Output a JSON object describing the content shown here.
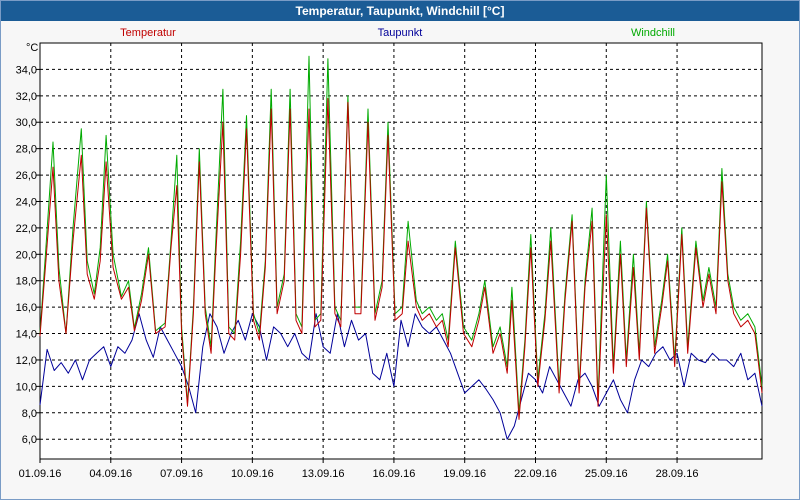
{
  "window": {
    "title": "Temperatur, Taupunkt, Windchill [°C]"
  },
  "chart_data": {
    "type": "line",
    "title": "Temperatur, Taupunkt, Windchill [°C]",
    "ylabel": "°C",
    "xlabel": "",
    "ylim": [
      4.5,
      36.0
    ],
    "xlim": [
      0,
      30.6
    ],
    "yticks": [
      6.0,
      8.0,
      10.0,
      12.0,
      14.0,
      16.0,
      18.0,
      20.0,
      22.0,
      24.0,
      26.0,
      28.0,
      30.0,
      32.0,
      34.0
    ],
    "ytick_labels": [
      "6,0",
      "8,0",
      "10,0",
      "12,0",
      "14,0",
      "16,0",
      "18,0",
      "20,0",
      "22,0",
      "24,0",
      "26,0",
      "28,0",
      "30,0",
      "32,0",
      "34,0"
    ],
    "xticks": [
      0,
      3,
      6,
      9,
      12,
      15,
      18,
      21,
      24,
      27
    ],
    "xtick_labels": [
      "01.09.16",
      "04.09.16",
      "07.09.16",
      "10.09.16",
      "13.09.16",
      "16.09.16",
      "19.09.16",
      "22.09.16",
      "25.09.16",
      "28.09.16"
    ],
    "grid": true,
    "legend_position": "top",
    "series": [
      {
        "name": "Temperatur",
        "color": "#c00000",
        "x": [
          0.0,
          0.25,
          0.55,
          0.8,
          1.1,
          1.4,
          1.75,
          2.0,
          2.3,
          2.55,
          2.8,
          3.1,
          3.45,
          3.75,
          4.0,
          4.3,
          4.6,
          4.9,
          5.3,
          5.55,
          5.8,
          6.0,
          6.25,
          6.5,
          6.75,
          7.0,
          7.25,
          7.45,
          7.75,
          8.0,
          8.25,
          8.5,
          8.75,
          9.05,
          9.3,
          9.55,
          9.8,
          10.05,
          10.35,
          10.6,
          10.85,
          11.1,
          11.4,
          11.65,
          11.9,
          12.2,
          12.5,
          12.75,
          13.05,
          13.35,
          13.6,
          13.9,
          14.2,
          14.5,
          14.75,
          15.05,
          15.35,
          15.6,
          15.95,
          16.2,
          16.5,
          16.8,
          17.05,
          17.3,
          17.6,
          17.95,
          18.3,
          18.6,
          18.85,
          19.2,
          19.5,
          19.8,
          20.0,
          20.3,
          20.55,
          20.8,
          21.1,
          21.4,
          21.65,
          22.0,
          22.25,
          22.55,
          22.85,
          23.1,
          23.4,
          23.65,
          24.0,
          24.3,
          24.6,
          24.85,
          25.15,
          25.4,
          25.7,
          26.05,
          26.35,
          26.6,
          26.9,
          27.2,
          27.45,
          27.8,
          28.1,
          28.35,
          28.65,
          28.9,
          29.15,
          29.4,
          29.7,
          30.0,
          30.3,
          30.6
        ],
        "values": [
          13.8,
          19.5,
          26.6,
          18.0,
          14.0,
          21.0,
          27.5,
          18.5,
          16.6,
          19.5,
          27.0,
          19.0,
          16.6,
          17.5,
          14.2,
          16.5,
          20.0,
          14.0,
          14.5,
          20.5,
          25.2,
          14.0,
          8.5,
          15.5,
          27.0,
          15.5,
          12.5,
          20.0,
          30.0,
          14.0,
          13.5,
          20.0,
          29.5,
          15.0,
          13.5,
          19.0,
          31.0,
          15.5,
          18.0,
          31.0,
          15.0,
          14.0,
          31.0,
          14.5,
          15.0,
          31.8,
          15.5,
          14.5,
          31.5,
          15.5,
          15.5,
          30.0,
          15.0,
          17.5,
          29.0,
          15.0,
          15.5,
          21.0,
          16.0,
          15.0,
          15.5,
          14.5,
          15.0,
          13.0,
          20.5,
          14.0,
          13.0,
          15.0,
          17.5,
          12.5,
          14.0,
          11.0,
          16.5,
          7.5,
          13.0,
          20.5,
          10.0,
          15.0,
          21.0,
          9.5,
          16.5,
          22.5,
          9.5,
          17.5,
          22.5,
          8.5,
          23.0,
          11.0,
          20.0,
          11.5,
          19.0,
          12.0,
          23.5,
          12.5,
          16.0,
          19.5,
          11.5,
          21.5,
          12.5,
          20.5,
          16.0,
          18.5,
          15.5,
          25.5,
          18.0,
          15.5,
          14.5,
          15.0,
          14.0,
          9.5
        ]
      },
      {
        "name": "Taupunkt",
        "color": "#000099",
        "x": [
          0.0,
          0.3,
          0.6,
          0.9,
          1.2,
          1.5,
          1.8,
          2.1,
          2.4,
          2.7,
          3.0,
          3.3,
          3.6,
          3.9,
          4.2,
          4.5,
          4.8,
          5.1,
          5.4,
          5.7,
          6.0,
          6.3,
          6.6,
          6.9,
          7.2,
          7.5,
          7.8,
          8.1,
          8.4,
          8.7,
          9.0,
          9.3,
          9.6,
          9.9,
          10.2,
          10.5,
          10.8,
          11.1,
          11.4,
          11.7,
          12.0,
          12.3,
          12.6,
          12.9,
          13.2,
          13.5,
          13.8,
          14.1,
          14.4,
          14.7,
          15.0,
          15.3,
          15.6,
          15.9,
          16.2,
          16.5,
          16.8,
          17.1,
          17.4,
          17.7,
          18.0,
          18.3,
          18.6,
          18.9,
          19.2,
          19.5,
          19.8,
          20.1,
          20.4,
          20.7,
          21.0,
          21.3,
          21.6,
          21.9,
          22.2,
          22.5,
          22.8,
          23.1,
          23.4,
          23.7,
          24.0,
          24.3,
          24.6,
          24.9,
          25.2,
          25.5,
          25.8,
          26.1,
          26.4,
          26.7,
          27.0,
          27.3,
          27.6,
          27.9,
          28.2,
          28.5,
          28.8,
          29.1,
          29.4,
          29.7,
          30.0,
          30.3,
          30.6
        ],
        "values": [
          8.6,
          12.8,
          11.2,
          11.8,
          11.0,
          12.0,
          10.5,
          12.0,
          12.5,
          13.0,
          11.5,
          13.0,
          12.5,
          13.5,
          15.5,
          13.5,
          12.2,
          14.5,
          13.5,
          12.5,
          11.5,
          10.0,
          8.0,
          13.0,
          15.5,
          14.5,
          12.5,
          14.0,
          15.0,
          13.5,
          15.5,
          14.5,
          12.0,
          14.5,
          14.0,
          13.0,
          14.0,
          12.5,
          12.0,
          15.5,
          13.0,
          12.5,
          15.5,
          13.0,
          15.0,
          13.5,
          14.0,
          11.0,
          10.5,
          12.5,
          10.0,
          15.0,
          13.0,
          15.5,
          14.5,
          14.0,
          14.5,
          13.5,
          12.5,
          11.0,
          9.5,
          10.0,
          10.5,
          9.8,
          9.0,
          8.0,
          6.0,
          7.0,
          9.0,
          11.0,
          10.5,
          9.5,
          11.5,
          10.5,
          9.5,
          8.5,
          10.5,
          11.0,
          10.0,
          8.5,
          9.5,
          10.5,
          9.0,
          8.0,
          10.5,
          12.0,
          11.5,
          12.5,
          13.0,
          12.0,
          12.5,
          10.0,
          12.5,
          12.0,
          11.8,
          12.5,
          12.0,
          12.0,
          11.5,
          12.5,
          10.5,
          11.0,
          8.5
        ]
      },
      {
        "name": "Windchill",
        "color": "#00aa00",
        "x": [
          0.0,
          0.25,
          0.55,
          0.8,
          1.1,
          1.4,
          1.75,
          2.0,
          2.3,
          2.55,
          2.8,
          3.1,
          3.45,
          3.75,
          4.0,
          4.3,
          4.6,
          4.9,
          5.3,
          5.55,
          5.8,
          6.0,
          6.25,
          6.5,
          6.75,
          7.0,
          7.25,
          7.45,
          7.75,
          8.0,
          8.25,
          8.5,
          8.75,
          9.05,
          9.3,
          9.55,
          9.8,
          10.05,
          10.35,
          10.6,
          10.85,
          11.1,
          11.4,
          11.65,
          11.9,
          12.2,
          12.5,
          12.75,
          13.05,
          13.35,
          13.6,
          13.9,
          14.2,
          14.5,
          14.75,
          15.05,
          15.35,
          15.6,
          15.95,
          16.2,
          16.5,
          16.8,
          17.05,
          17.3,
          17.6,
          17.95,
          18.3,
          18.6,
          18.85,
          19.2,
          19.5,
          19.8,
          20.0,
          20.3,
          20.55,
          20.8,
          21.1,
          21.4,
          21.65,
          22.0,
          22.25,
          22.55,
          22.85,
          23.1,
          23.4,
          23.65,
          24.0,
          24.3,
          24.6,
          24.85,
          25.15,
          25.4,
          25.7,
          26.05,
          26.35,
          26.6,
          26.9,
          27.2,
          27.45,
          27.8,
          28.1,
          28.35,
          28.65,
          28.9,
          29.15,
          29.4,
          29.7,
          30.0,
          30.3,
          30.6
        ],
        "values": [
          14.0,
          20.5,
          28.5,
          19.0,
          14.0,
          22.0,
          29.5,
          19.5,
          17.0,
          20.5,
          29.0,
          20.0,
          16.8,
          18.0,
          14.4,
          17.0,
          20.5,
          14.2,
          14.8,
          21.0,
          27.5,
          14.5,
          8.7,
          16.0,
          28.0,
          16.0,
          13.0,
          21.0,
          32.5,
          14.5,
          14.0,
          21.0,
          30.5,
          15.5,
          14.0,
          19.5,
          32.5,
          16.0,
          18.5,
          32.5,
          15.5,
          14.5,
          35.0,
          15.0,
          15.5,
          34.8,
          16.0,
          15.0,
          32.0,
          16.0,
          16.0,
          31.0,
          15.5,
          18.0,
          30.0,
          15.5,
          16.0,
          22.5,
          16.5,
          15.5,
          16.0,
          15.0,
          15.5,
          13.5,
          21.0,
          14.5,
          13.5,
          15.5,
          18.0,
          13.0,
          14.5,
          11.5,
          17.5,
          8.0,
          13.5,
          21.5,
          10.5,
          15.5,
          22.0,
          10.0,
          17.0,
          23.0,
          10.0,
          18.0,
          23.5,
          9.0,
          26.0,
          11.5,
          21.0,
          12.0,
          20.0,
          12.5,
          24.0,
          13.0,
          16.5,
          20.0,
          12.0,
          22.0,
          13.0,
          21.0,
          16.5,
          19.0,
          16.0,
          26.5,
          18.5,
          16.0,
          15.0,
          15.5,
          14.5,
          10.0
        ]
      }
    ]
  }
}
